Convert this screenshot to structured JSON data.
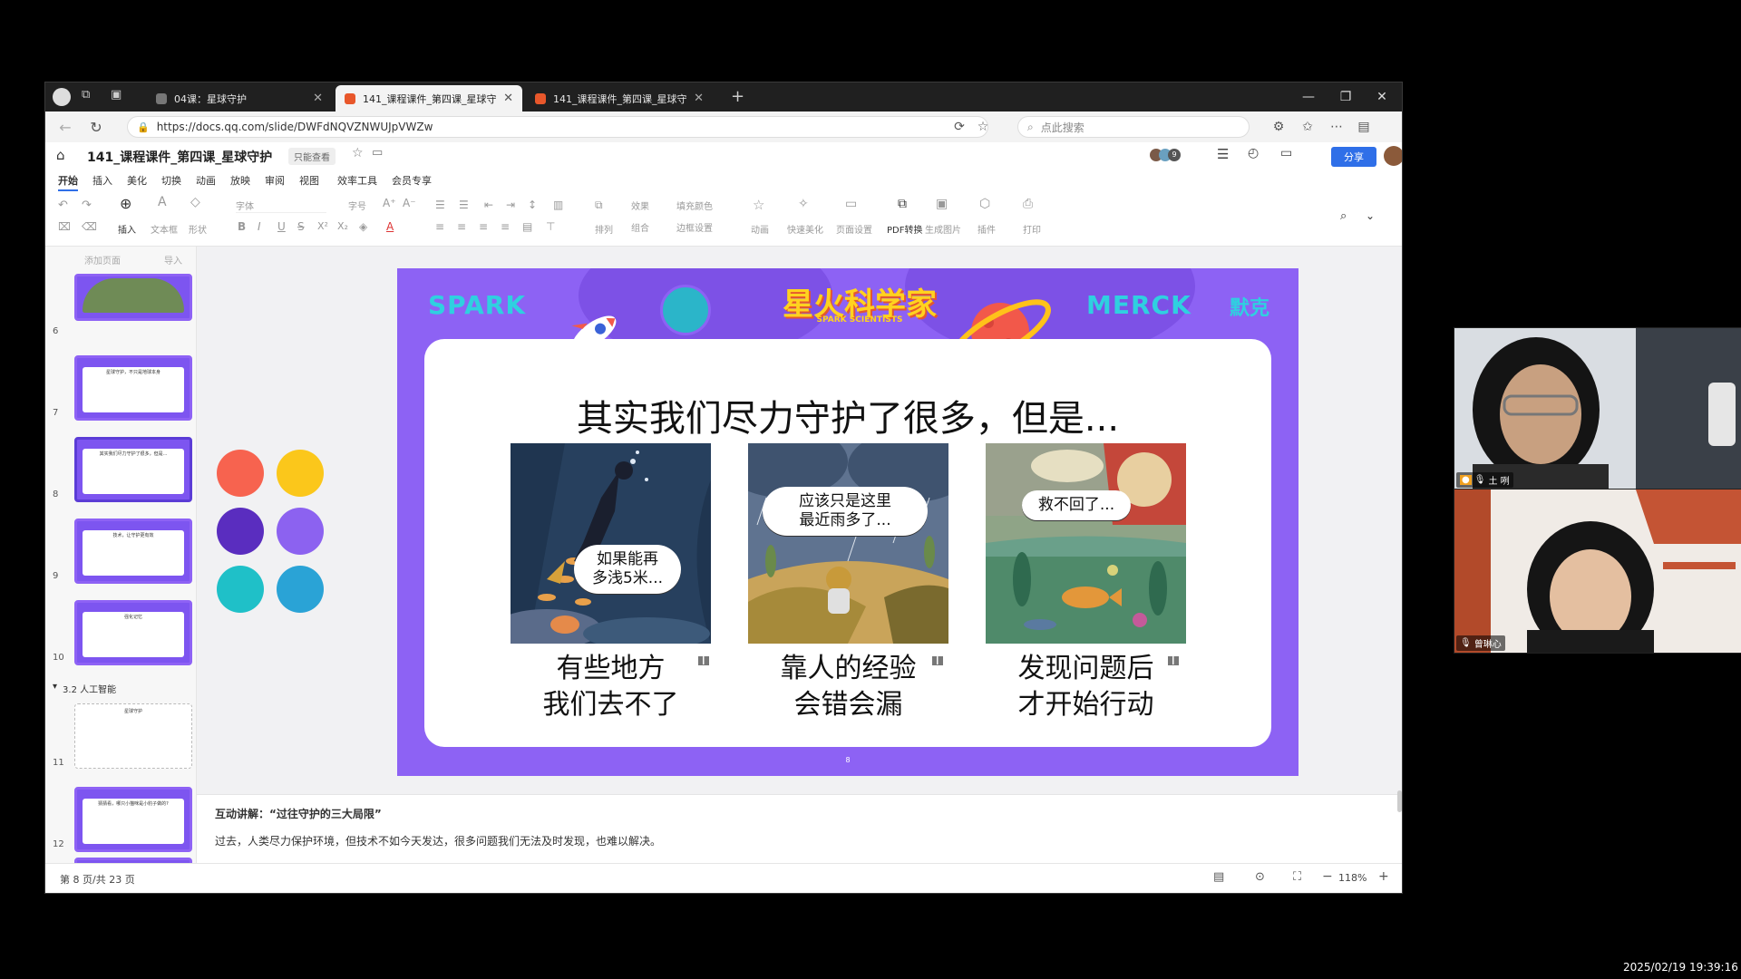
{
  "browser": {
    "tabs": [
      {
        "label": "04课：星球守护",
        "active": false
      },
      {
        "label": "141_课程课件_第四课_星球守护",
        "active": true
      },
      {
        "label": "141_课程课件_第四课_星球守护",
        "active": false
      }
    ],
    "url": "https://docs.qq.com/slide/DWFdNQVZNWUJpVWZw",
    "search_placeholder": "点此搜索"
  },
  "doc": {
    "title": "141_课程课件_第四课_星球守护",
    "readonly_badge": "只能查看",
    "share_label": "分享",
    "collab_count": "9"
  },
  "menu": [
    "开始",
    "插入",
    "美化",
    "切换",
    "动画",
    "放映",
    "审阅",
    "视图",
    "效率工具",
    "会员专享"
  ],
  "toolbar": {
    "insert": "插入",
    "textbox": "文本框",
    "shape": "形状",
    "font": "字体",
    "font_size": "字号",
    "effect": "效果",
    "fill_color": "填充颜色",
    "arrange": "排列",
    "combine": "组合",
    "border_settings": "边框设置",
    "animation": "动画",
    "quick_beautify": "快速美化",
    "page_setup": "页面设置",
    "pdf_convert": "PDF转换",
    "generate_image": "生成图片",
    "plugin": "插件",
    "print": "打印"
  },
  "sidebar": {
    "add_page": "添加页面",
    "import": "导入",
    "thumbnails": [
      {
        "num": "6"
      },
      {
        "num": "7",
        "text": "星球守护，不只是地球本身"
      },
      {
        "num": "8",
        "text": "其实我们尽力守护了很多，但是..."
      },
      {
        "num": "9",
        "text": "技术，让守护更有效"
      },
      {
        "num": "10",
        "text": "强化记忆"
      },
      {
        "num": "11",
        "text": "星球守护"
      },
      {
        "num": "12",
        "text": "猜猜看，哪只小猫咪是小豹子做的?"
      }
    ],
    "section_label": "3.2 人工智能"
  },
  "slide": {
    "logo_left": "SPARK",
    "banner_title": "星火科学家",
    "banner_subtitle": "SPARK SCIENTISTS",
    "logo_right": "MERCK",
    "logo_right_cn": "默克",
    "heading": "其实我们尽力守护了很多，但是...",
    "panels": [
      {
        "bubble_l1": "如果能再",
        "bubble_l2": "多浅5米...",
        "cap_l1": "有些地方",
        "cap_l2": "我们去不了"
      },
      {
        "bubble_l1": "应该只是这里",
        "bubble_l2": "最近雨多了...",
        "cap_l1": "靠人的经验",
        "cap_l2": "会错会漏"
      },
      {
        "bubble_l1": "救不回了...",
        "bubble_l2": "",
        "cap_l1": "发现问题后",
        "cap_l2": "才开始行动"
      }
    ],
    "page_number": "8",
    "palette": [
      "#f7634f",
      "#fbc71b",
      "#5a2dbf",
      "#8c62f0",
      "#1fc0c8",
      "#2aa3d6"
    ]
  },
  "notes": {
    "heading": "互动讲解：“过往守护的三大局限”",
    "body": "过去，人类尽力保护环境，但技术不如今天发达，很多问题我们无法及时发现，也难以解决。"
  },
  "status": {
    "page_info": "第 8 页/共 23 页",
    "zoom": "118%"
  },
  "participants": [
    {
      "name": "土 咧"
    },
    {
      "name": "曾琳心"
    }
  ],
  "timestamp": "2025/02/19 19:39:16"
}
